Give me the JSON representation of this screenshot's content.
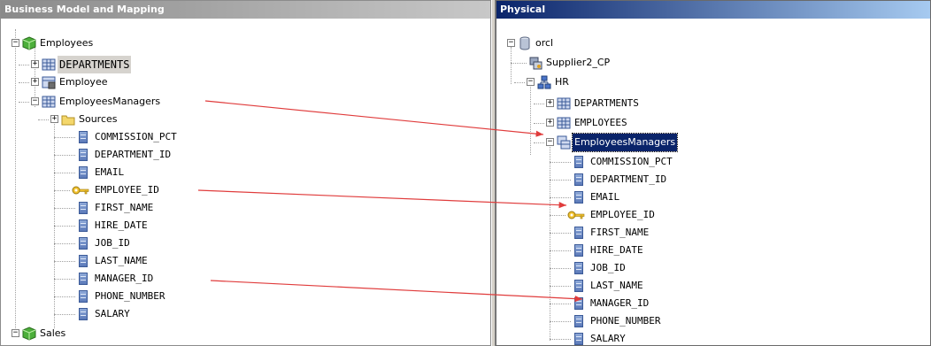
{
  "left": {
    "title": "Business Model and Mapping",
    "root": "Employees",
    "tables": [
      "DEPARTMENTS",
      "Employee",
      "EmployeesManagers"
    ],
    "sources": "Sources",
    "columns": [
      "COMMISSION_PCT",
      "DEPARTMENT_ID",
      "EMAIL",
      "EMPLOYEE_ID",
      "FIRST_NAME",
      "HIRE_DATE",
      "JOB_ID",
      "LAST_NAME",
      "MANAGER_ID",
      "PHONE_NUMBER",
      "SALARY"
    ],
    "root2": "Sales"
  },
  "right": {
    "title": "Physical",
    "db": "orcl",
    "pool": "Supplier2_CP",
    "schema": "HR",
    "tables": [
      "DEPARTMENTS",
      "EMPLOYEES",
      "EmployeesManagers"
    ],
    "columns": [
      "COMMISSION_PCT",
      "DEPARTMENT_ID",
      "EMAIL",
      "EMPLOYEE_ID",
      "FIRST_NAME",
      "HIRE_DATE",
      "JOB_ID",
      "LAST_NAME",
      "MANAGER_ID",
      "PHONE_NUMBER",
      "SALARY"
    ]
  },
  "colors": {
    "arrow": "#e03c3c",
    "selection": "#0a246a"
  }
}
